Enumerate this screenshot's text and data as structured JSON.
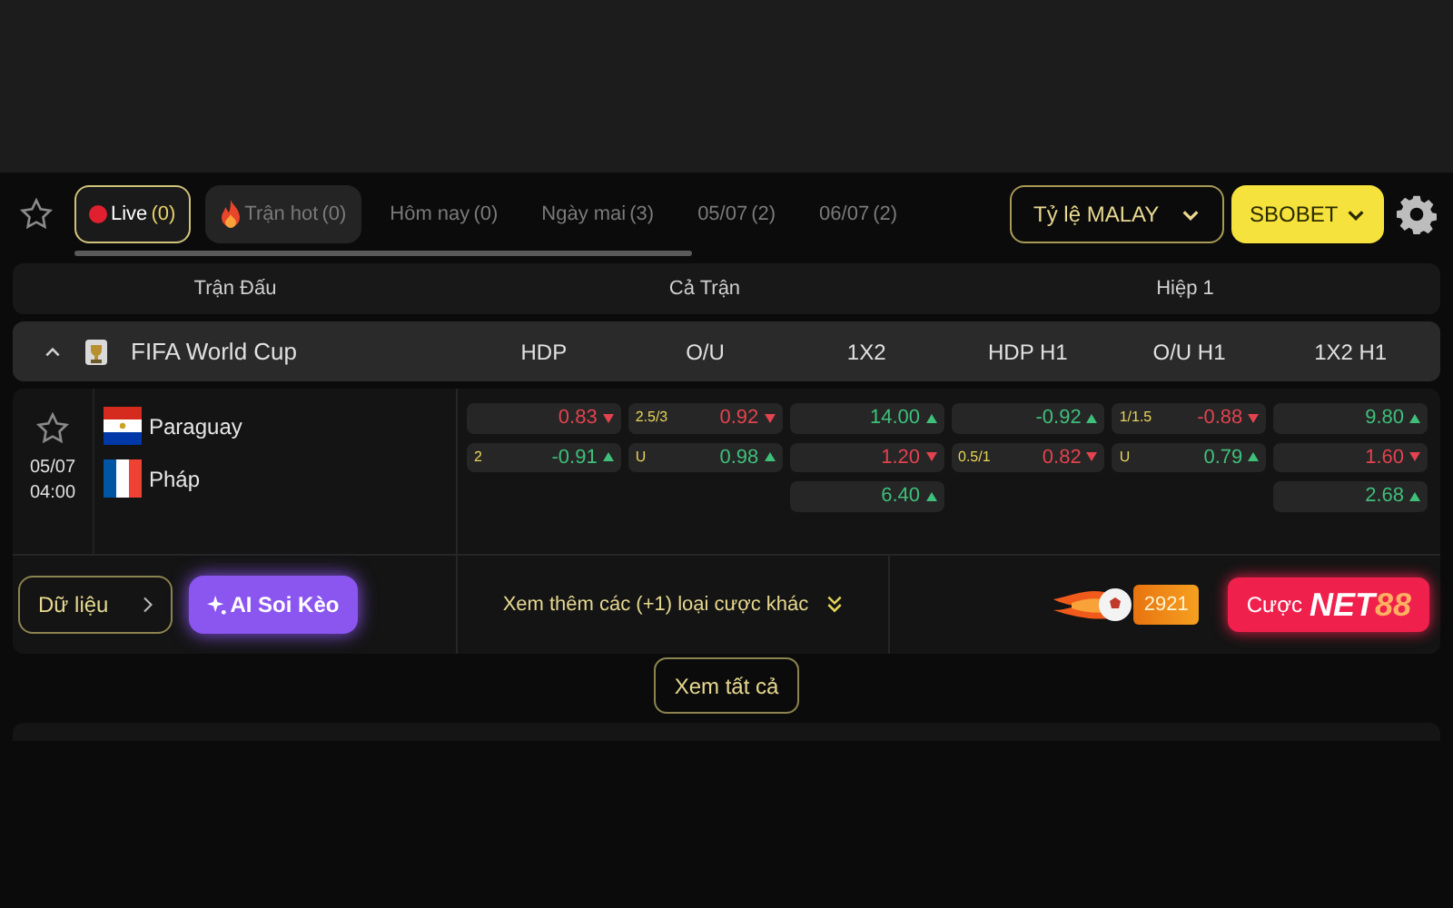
{
  "tabs": [
    {
      "kind": "live",
      "label": "Live",
      "count": "(0)",
      "selected": true
    },
    {
      "kind": "hot",
      "label": "Trận hot",
      "count": "(0)",
      "selected": false
    },
    {
      "kind": "plain",
      "label": "Hôm nay",
      "count": "(0)",
      "selected": false
    },
    {
      "kind": "plain",
      "label": "Ngày mai",
      "count": "(3)",
      "selected": false
    },
    {
      "kind": "plain",
      "label": "05/07",
      "count": "(2)",
      "selected": false
    },
    {
      "kind": "plain",
      "label": "06/07",
      "count": "(2)",
      "selected": false
    }
  ],
  "odds_format": {
    "label": "Tỷ lệ MALAY"
  },
  "bookmaker": {
    "label": "SBOBET"
  },
  "header": {
    "match": "Trận Đấu",
    "full_time": "Cả Trận",
    "first_half": "Hiệp 1"
  },
  "league": {
    "name": "FIFA World Cup",
    "expanded": true,
    "columns": [
      "HDP",
      "O/U",
      "1X2",
      "HDP H1",
      "O/U H1",
      "1X2 H1"
    ]
  },
  "match": {
    "date": "05/07",
    "time": "04:00",
    "teams": [
      {
        "name": "Paraguay",
        "kind": "paraguay"
      },
      {
        "name": "Pháp",
        "kind": "france"
      }
    ],
    "odds": [
      [
        {
          "value": "0.83",
          "kind": "down"
        },
        {
          "line": "2",
          "value": "-0.91",
          "kind": "up"
        }
      ],
      [
        {
          "line": "2.5/3",
          "value": "0.92",
          "kind": "down"
        },
        {
          "line": "U",
          "value": "0.98",
          "kind": "up"
        }
      ],
      [
        {
          "value": "14.00",
          "kind": "up"
        },
        {
          "value": "1.20",
          "kind": "down"
        },
        {
          "value": "6.40",
          "kind": "up"
        }
      ],
      [
        {
          "value": "-0.92",
          "kind": "up"
        },
        {
          "line": "0.5/1",
          "value": "0.82",
          "kind": "down"
        }
      ],
      [
        {
          "line": "1/1.5",
          "value": "-0.88",
          "kind": "down"
        },
        {
          "line": "U",
          "value": "0.79",
          "kind": "up"
        }
      ],
      [
        {
          "value": "9.80",
          "kind": "up"
        },
        {
          "value": "1.60",
          "kind": "down"
        },
        {
          "value": "2.68",
          "kind": "up"
        }
      ]
    ]
  },
  "footer": {
    "data_button": "Dữ liệu",
    "ai_button": "AI Soi Kèo",
    "more_bets": "Xem thêm các (+1) loại cược khác",
    "badge": "2921",
    "bet_button": {
      "prefix": "Cược",
      "brand": "NET",
      "brand_suffix": "88"
    }
  },
  "view_all": "Xem tất cả"
}
